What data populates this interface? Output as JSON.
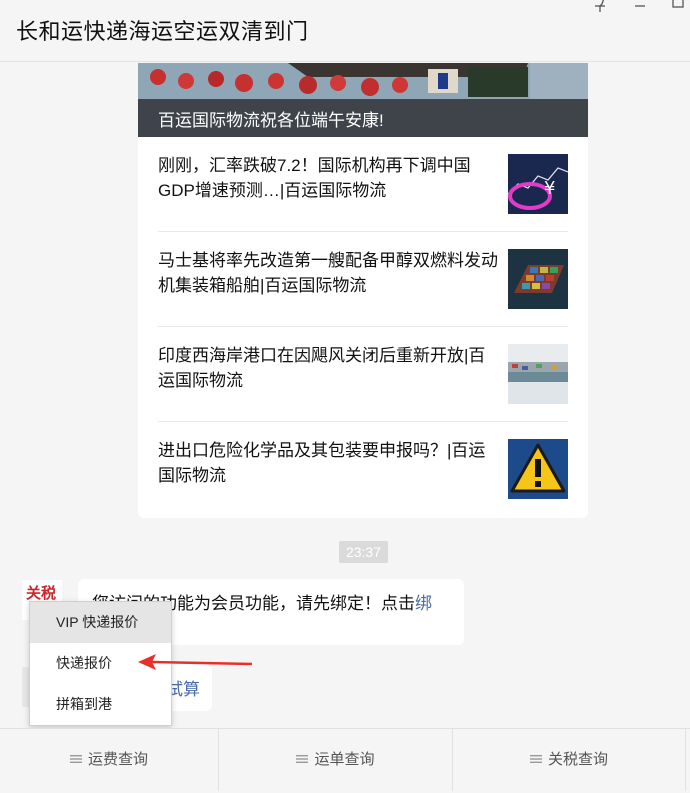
{
  "window": {
    "title": "长和运快递海运空运双清到门"
  },
  "article_card": {
    "hero_caption": "百运国际物流祝各位端午安康!",
    "items": [
      {
        "title": "刚刚，汇率跌破7.2！国际机构再下调中国GDP增速预测…|百运国际物流",
        "thumb_icon": "currency-chart-thumbnail"
      },
      {
        "title": "马士基将率先改造第一艘配备甲醇双燃料发动机集装箱船舶|百运国际物流",
        "thumb_icon": "container-ship-thumbnail"
      },
      {
        "title": "印度西海岸港口在因飓风关闭后重新开放|百运国际物流",
        "thumb_icon": "port-thumbnail"
      },
      {
        "title": "进出口危险化学品及其包装要申报吗？|百运国际物流",
        "thumb_icon": "warning-sign-thumbnail"
      }
    ]
  },
  "timestamp": "23:37",
  "avatar_text": "关税",
  "message1": {
    "text": "您访问的功能为会员功能，请先绑定！点击",
    "link": "绑"
  },
  "message2": {
    "link": "试算"
  },
  "popup_menu": {
    "items": [
      "VIP 快递报价",
      "快递报价",
      "拼箱到港"
    ]
  },
  "bottom_menu": {
    "items": [
      "运费查询",
      "运单查询",
      "关税查询"
    ]
  },
  "colors": {
    "link": "#4a6aa8",
    "arrow": "#e8302a",
    "background": "#f5f5f5"
  }
}
